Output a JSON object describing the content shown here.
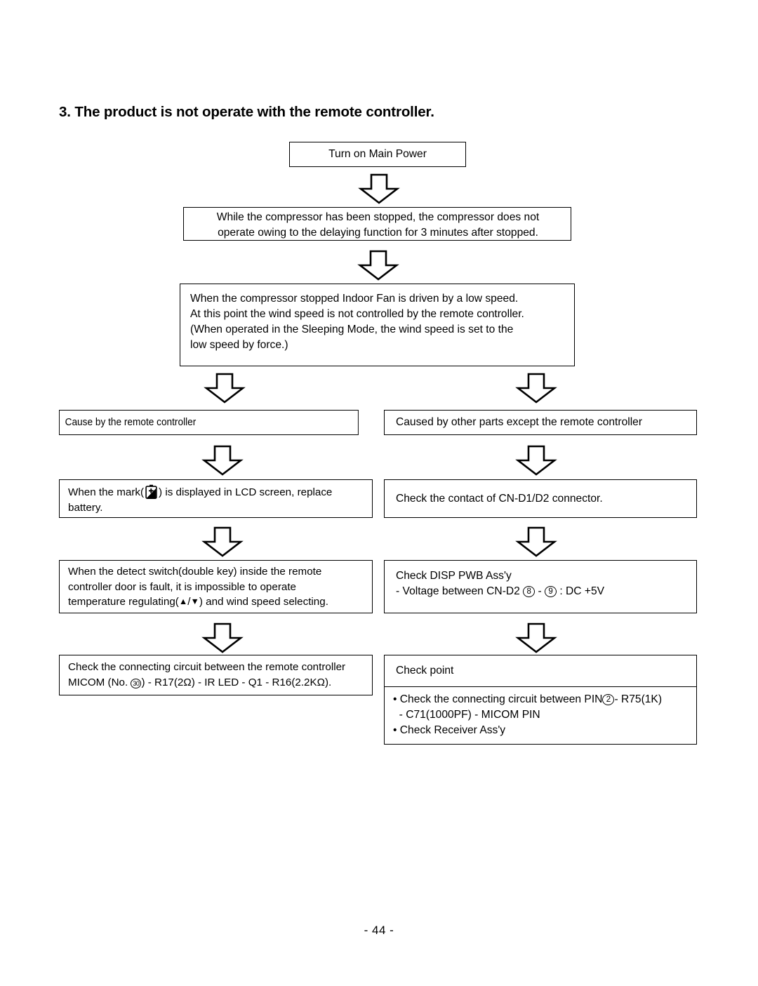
{
  "document": {
    "section_title": "3. The product is not operate with the remote controller.",
    "page_footer": "- 44 -"
  },
  "flowchart": {
    "start": {
      "label": "Turn on Main Power"
    },
    "delay_note": {
      "line1": "While the compressor has been stopped, the compressor does not",
      "line2": "operate owing to the delaying function for 3 minutes after stopped."
    },
    "fan_note": {
      "line1": "When the compressor stopped Indoor Fan is driven by a low speed.",
      "line2": "At this point the wind speed is not controlled by the remote controller.",
      "line3": "(When operated in the Sleeping Mode, the wind speed is set to the",
      "line4": "low speed by force.)"
    },
    "branch_left": {
      "cause": "Cause by the remote controller",
      "battery": {
        "part1": "When the mark(",
        "icon": "battery-low-icon",
        "part2": ") is displayed in LCD screen, replace",
        "part3": "battery."
      },
      "detect_switch": {
        "line1": "When the detect switch(double key) inside the remote",
        "line2": "controller door is fault, it is impossible to operate",
        "line3_pre": "temperature regulating(",
        "line3_up": "▲",
        "line3_sep": "/",
        "line3_down": "▼",
        "line3_post": ") and wind speed selecting."
      },
      "micom_circuit": {
        "line1": "Check the connecting circuit between the remote controller",
        "line2_pre": "MICOM (No. ",
        "line2_circled": "30",
        "line2_post": ") - R17(2Ω) - IR LED - Q1 - R16(2.2KΩ)."
      }
    },
    "branch_right": {
      "cause": "Caused by other parts except the remote controller",
      "connector": "Check the contact of CN-D1/D2 connector.",
      "disp_pwb": {
        "line1": "Check DISP PWB Ass'y",
        "line2_pre": "- Voltage between CN-D2 ",
        "line2_pin_a": "8",
        "line2_mid": " - ",
        "line2_pin_b": "9",
        "line2_post": " : DC +5V"
      },
      "check_point": {
        "header": "Check point",
        "bullet1_pre": "• Check the connecting circuit between PIN",
        "bullet1_circled": "2",
        "bullet1_post": "- R75(1K)",
        "bullet1_cont": "  - C71(1000PF) - MICOM PIN",
        "bullet2": "• Check Receiver Ass'y"
      }
    }
  },
  "icons": {
    "down_arrow": "down-block-arrow-icon",
    "battery": "battery-low-icon",
    "triangle_up": "triangle-up-icon",
    "triangle_down": "triangle-down-icon"
  },
  "colors": {
    "ink": "#000000",
    "paper": "#ffffff"
  }
}
